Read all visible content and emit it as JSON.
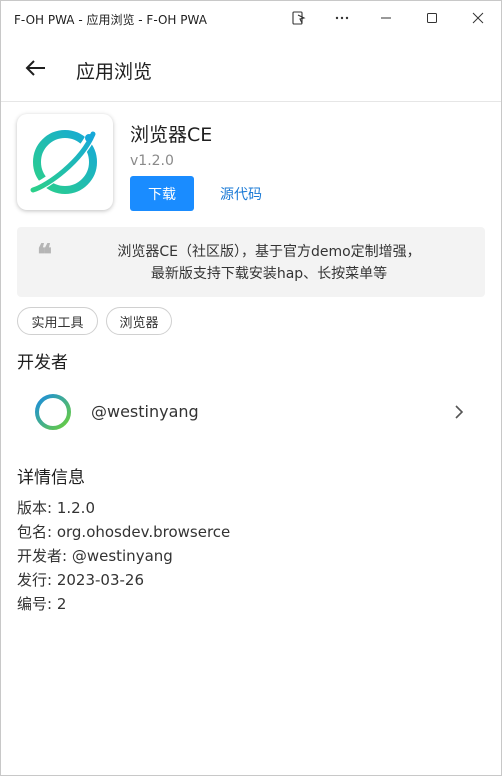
{
  "window": {
    "title": "F-OH PWA - 应用浏览 - F-OH PWA",
    "controls": [
      "app-menu-icon",
      "more-icon",
      "minimize-icon",
      "maximize-icon",
      "close-icon"
    ]
  },
  "appbar": {
    "title": "应用浏览",
    "back_icon": "arrow-left-icon"
  },
  "app": {
    "name": "浏览器CE",
    "version": "v1.2.0",
    "download_label": "下载",
    "source_label": "源代码",
    "icon": "planet-browser-icon",
    "accent": "#1a8cff"
  },
  "description": {
    "line1": "浏览器CE（社区版），基于官方demo定制增强，",
    "line2": "最新版支持下载安装hap、长按菜单等"
  },
  "tags": [
    "实用工具",
    "浏览器"
  ],
  "developer_section": {
    "title": "开发者",
    "name": "@westinyang",
    "avatar_icon": "ring-avatar-icon"
  },
  "details_section": {
    "title": "详情信息",
    "items": [
      "版本: 1.2.0",
      "包名: org.ohosdev.browserce",
      "开发者: @westinyang",
      "发行: 2023-03-26",
      "编号: 2"
    ]
  }
}
